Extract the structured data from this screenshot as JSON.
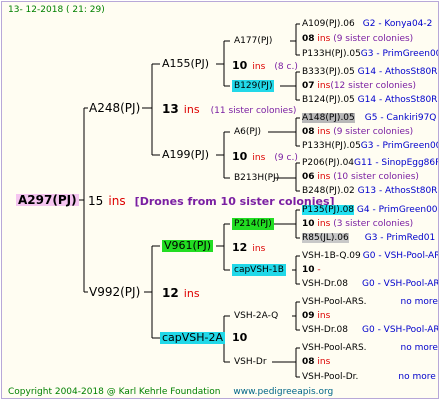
{
  "header": {
    "date": "13- 12-2018 ( 21: 29)"
  },
  "footer": {
    "copyright": "Copyright 2004-2018 @ Karl Kehrle Foundation",
    "site": "www.pedigreeapis.org"
  },
  "root": {
    "id": "A297(PJ)",
    "num": "15",
    "ins": "ins",
    "note": "[Drones from 10 sister colonies]"
  },
  "gen1": [
    {
      "id": "A248(PJ)",
      "num": "13",
      "ins": "ins",
      "note": "(11 sister colonies)"
    },
    {
      "id": "V992(PJ)",
      "num": "12",
      "ins": "ins"
    }
  ],
  "gen2": [
    {
      "id": "A155(PJ)",
      "num": "10",
      "ins": "ins",
      "note": "(8 c.)"
    },
    {
      "id": "A199(PJ)",
      "num": "10",
      "ins": "ins",
      "note": "(9 c.)"
    },
    {
      "id": "V961(PJ)",
      "num": "12",
      "ins": "ins"
    },
    {
      "id": "capVSH-2A",
      "num": "10"
    }
  ],
  "gen3": [
    {
      "id": "A177(PJ)",
      "num": "10",
      "ins": "ins",
      "note": "(8 c.)"
    },
    {
      "id": "B129(PJ)"
    },
    {
      "id": "A6(PJ)",
      "num": "10",
      "ins": "ins",
      "note": "(9 c.)"
    },
    {
      "id": "B213H(PJ)"
    },
    {
      "id": "P214(PJ)",
      "num": "10",
      "ins": "ins"
    },
    {
      "id": "capVSH-1B"
    },
    {
      "id": "VSH-2A-Q",
      "num": "10",
      "ins": "ins"
    },
    {
      "id": "VSH-Dr"
    }
  ],
  "gen4": [
    {
      "id": "A109(PJ).06",
      "tail": "G2 - Konya04-2"
    },
    {
      "num": "08",
      "ins": "ins",
      "note": "(9 sister colonies)"
    },
    {
      "id": "P133H(PJ).05",
      "tail": "G3 - PrimGreen00"
    },
    {
      "id": "B333(PJ).05",
      "tail": "G14 - AthosSt80R"
    },
    {
      "num": "07",
      "ins": "ins",
      "note": "(12 sister colonies)"
    },
    {
      "id": "B124(PJ).05",
      "tail": "G14 - AthosSt80R"
    },
    {
      "id": "A148(PJ).05",
      "tail": "G5 - Cankiri97Q"
    },
    {
      "num": "08",
      "ins": "ins",
      "note": "(9 sister colonies)"
    },
    {
      "id": "P133H(PJ).05",
      "tail": "G3 - PrimGreen00"
    },
    {
      "id": "P206(PJ).04",
      "tail": "G11 - SinopEgg86R"
    },
    {
      "num": "06",
      "ins": "ins",
      "note": "(10 sister colonies)"
    },
    {
      "id": "B248(PJ).02",
      "tail": "G13 - AthosSt80R"
    },
    {
      "id": "P135(PJ).08",
      "tail": "G4 - PrimGreen00"
    },
    {
      "num": "10",
      "ins": "ins",
      "note": "(3 sister colonies)"
    },
    {
      "id": "R85(JL).06",
      "tail": "G3 - PrimRed01"
    },
    {
      "id": "VSH-1B-Q.09",
      "tail": "G0 - VSH-Pool-AR"
    },
    {
      "num": "10",
      "ins": "-"
    },
    {
      "id": "VSH-Dr.08",
      "tail": "G0 - VSH-Pool-AR"
    },
    {
      "id": "VSH-Pool-ARS.",
      "tail": "no more"
    },
    {
      "num": "09",
      "ins": "ins"
    },
    {
      "id": "VSH-Dr.08",
      "tail": "G0 - VSH-Pool-AR"
    },
    {
      "id": "VSH-Pool-ARS.",
      "tail": "no more"
    },
    {
      "num": "08",
      "ins": "ins"
    },
    {
      "id": "VSH-Pool-Dr.",
      "tail": "no more"
    }
  ],
  "colors": {
    "border": "#b8a8d8",
    "bg": "#fffdf2",
    "ins": "#dd0000",
    "note": "#7a1fa2",
    "tail": "#0000cc",
    "footer": "#008000"
  }
}
